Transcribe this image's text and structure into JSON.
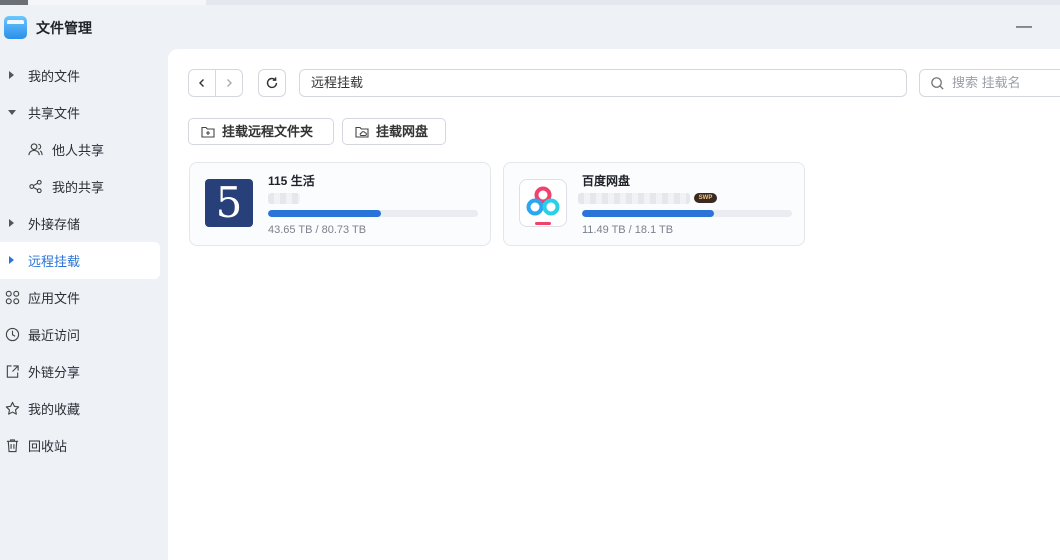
{
  "app": {
    "title": "文件管理"
  },
  "sidebar": {
    "items": [
      {
        "label": "我的文件"
      },
      {
        "label": "共享文件"
      },
      {
        "label": "他人共享"
      },
      {
        "label": "我的共享"
      },
      {
        "label": "外接存储"
      },
      {
        "label": "远程挂载"
      },
      {
        "label": "应用文件"
      },
      {
        "label": "最近访问"
      },
      {
        "label": "外链分享"
      },
      {
        "label": "我的收藏"
      },
      {
        "label": "回收站"
      }
    ]
  },
  "toolbar": {
    "path": "远程挂载",
    "search_placeholder": "搜索 挂载名"
  },
  "actions": {
    "mount_remote_folder": "挂载远程文件夹",
    "mount_cloud_disk": "挂载网盘"
  },
  "mounts": [
    {
      "name": "115 生活",
      "logo_text": "5",
      "usage": "43.65 TB / 80.73 TB",
      "used_fraction": 0.54,
      "badge": ""
    },
    {
      "name": "百度网盘",
      "usage": "11.49 TB / 18.1 TB",
      "used_fraction": 0.63,
      "badge": "SWP"
    }
  ],
  "colors": {
    "accent": "#2a73d8",
    "active_text": "#2b74d6"
  }
}
